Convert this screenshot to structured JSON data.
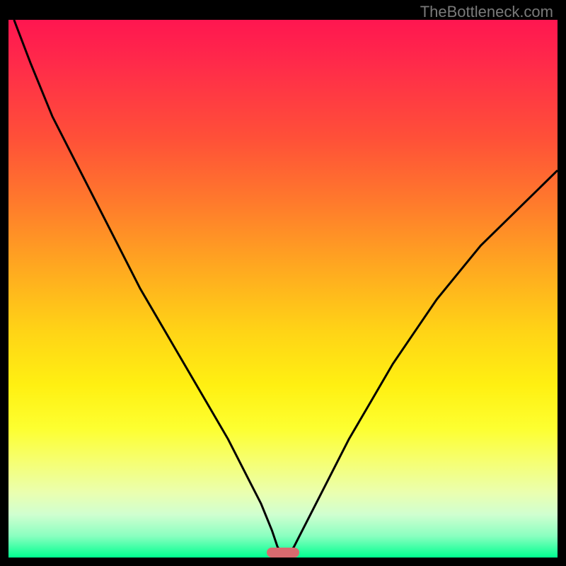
{
  "watermark": "TheBottleneck.com",
  "chart_data": {
    "type": "line",
    "title": "",
    "xlabel": "",
    "ylabel": "",
    "xlim": [
      0,
      100
    ],
    "ylim": [
      0,
      100
    ],
    "grid": false,
    "legend": false,
    "series": [
      {
        "name": "curve",
        "x": [
          1,
          4,
          8,
          12,
          16,
          20,
          24,
          28,
          32,
          36,
          40,
          44,
          46,
          48,
          49,
          50,
          51,
          52,
          54,
          58,
          62,
          66,
          70,
          74,
          78,
          82,
          86,
          90,
          94,
          98,
          100
        ],
        "y": [
          100,
          92,
          82,
          74,
          66,
          58,
          50,
          43,
          36,
          29,
          22,
          14,
          10,
          5,
          2,
          0.5,
          0.5,
          2,
          6,
          14,
          22,
          29,
          36,
          42,
          48,
          53,
          58,
          62,
          66,
          70,
          72
        ]
      }
    ],
    "marker": {
      "name": "min-cap",
      "x_start": 47,
      "x_end": 53,
      "y": 0,
      "color": "#d86a6f"
    },
    "background_gradient": {
      "top": "#ff1650",
      "upper_mid": "#ffa820",
      "mid": "#fff012",
      "lower_mid": "#eaffb0",
      "bottom": "#00ff90"
    }
  }
}
